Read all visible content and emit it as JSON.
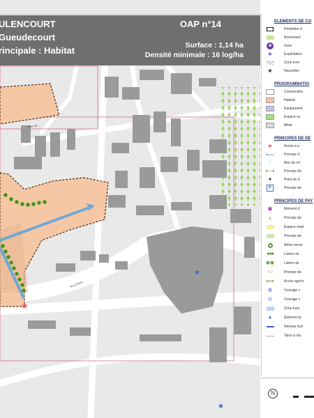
{
  "header": {
    "commune": "ULENCOURT",
    "secteur": "Gueudecourt",
    "vocation": "rincipale : Habitat",
    "oap_number": "OAP n°14",
    "surface": "Surface : 1,14 ha",
    "densite": "Densité minimale : 16 log/ha"
  },
  "map": {
    "street_labels": [
      "Rue du ...",
      "Rue Dessi..."
    ],
    "colors": {
      "background": "#e9e9e9",
      "building": "#9a9a9a",
      "road": "#ffffff",
      "habitat_zone": "#f6c7a4",
      "zone_outline": "#4a2a10",
      "perimeter": "#d46a8f",
      "hedge": "#86b83a",
      "access_arrow": "#6fa7d6",
      "green_spaces": "#8bc34a"
    },
    "icons": [
      "access-star-icon",
      "heritage-star-icon"
    ]
  },
  "legend": {
    "sections": [
      {
        "title": "ELEMENTS DE CO",
        "items": [
          {
            "label": "Périmètre d",
            "icon": "dashed-square-icon"
          },
          {
            "label": "Boisement",
            "icon": "pattern-icon"
          },
          {
            "label": "Gare",
            "icon": "train-circle-icon"
          },
          {
            "label": "Exploitation",
            "icon": "blue-star-icon"
          },
          {
            "label": "Zone inon",
            "icon": "hatch-icon"
          },
          {
            "label": "Nouvelles",
            "icon": "black-star-icon"
          }
        ]
      },
      {
        "title": "PROGRAMMATIO",
        "items": [
          {
            "label": "Concernées",
            "color": "#ffffff"
          },
          {
            "label": "Habitat",
            "color": "#f6c7a4"
          },
          {
            "label": "Equipement",
            "color": "#c9c3ea"
          },
          {
            "label": "Espace ve",
            "color": "#a8e07a"
          },
          {
            "label": "Mixte",
            "color": "#d9d9d9"
          }
        ]
      },
      {
        "title": "PRINCIPES DE DE",
        "items": [
          {
            "label": "Accès à a",
            "icon": "red-star-icon"
          },
          {
            "label": "Principe d",
            "icon": "blue-arrow-icon"
          },
          {
            "label": "Aire de ret",
            "icon": "dotted-icon"
          },
          {
            "label": "Principe de",
            "icon": "double-arrow-icon"
          },
          {
            "label": "Point de d",
            "icon": "dot-icon"
          },
          {
            "label": "Principe de",
            "icon": "parking-icon"
          }
        ]
      },
      {
        "title": "PRINCIPES DE PAY",
        "items": [
          {
            "label": "Elément d",
            "icon": "asterisk-icon"
          },
          {
            "label": "Principe de",
            "icon": "chevron-icon"
          },
          {
            "label": "Espace vegé",
            "icon": "yellow-square-icon"
          },
          {
            "label": "Principe de",
            "icon": "lightgreen-square-icon"
          },
          {
            "label": "Arbre remar",
            "icon": "ring-icon"
          },
          {
            "label": "Lisière de",
            "icon": "hedge-icon"
          },
          {
            "label": "Lisière de",
            "icon": "double-ring-icon"
          },
          {
            "label": "Principe de",
            "icon": "small-ring-icon"
          },
          {
            "label": "Accès agrico",
            "icon": "arrow-brown-icon"
          },
          {
            "label": "Ouvrage c",
            "icon": "blue-ring-icon"
          },
          {
            "label": "Ouvrage c",
            "icon": "blue-ring2-icon"
          },
          {
            "label": "Zone hum",
            "icon": "wet-zone-icon"
          },
          {
            "label": "Elément hy",
            "icon": "triangle-icon"
          },
          {
            "label": "Réseau hyd",
            "icon": "blue-line-icon"
          },
          {
            "label": "Talus à ma",
            "icon": "dotted-line-icon"
          }
        ]
      }
    ]
  }
}
